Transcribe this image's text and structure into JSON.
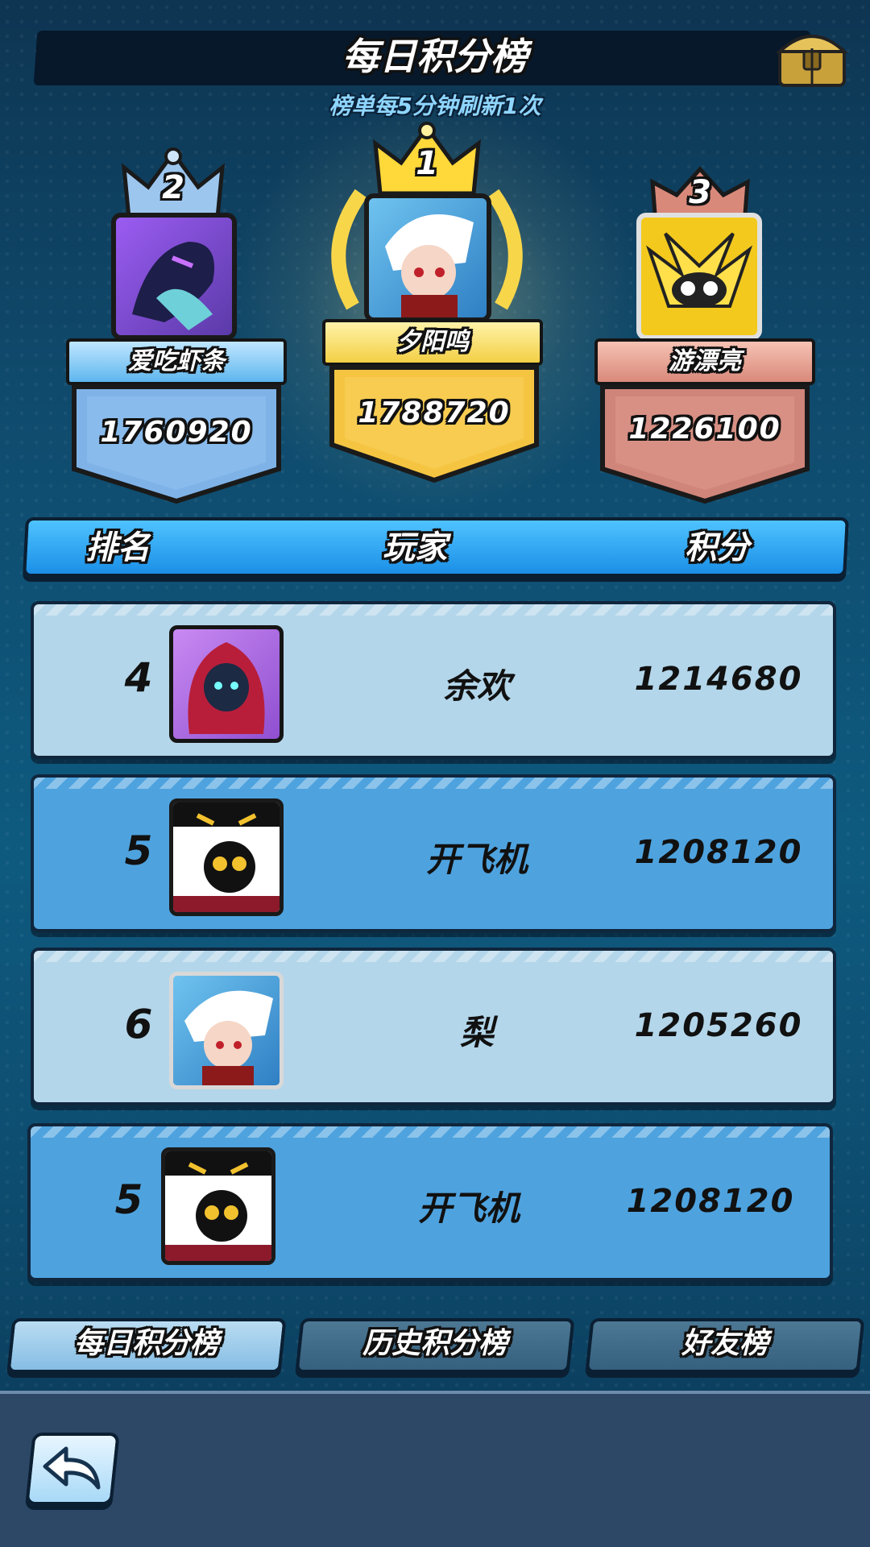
{
  "header": {
    "title": "每日积分榜",
    "subtitle": "榜单每5分钟刷新1次",
    "chest_icon": "treasure-chest-icon"
  },
  "podium": [
    {
      "rank": "1",
      "name": "夕阳鸣",
      "score": "1788720",
      "color": "#f5c542"
    },
    {
      "rank": "2",
      "name": "爱吃虾条",
      "score": "1760920",
      "color": "#7fb3e8"
    },
    {
      "rank": "3",
      "name": "游漂亮",
      "score": "1226100",
      "color": "#d9897a"
    }
  ],
  "table_header": {
    "rank": "排名",
    "player": "玩家",
    "score": "积分"
  },
  "rows": [
    {
      "rank": "4",
      "name": "余欢",
      "score": "1214680"
    },
    {
      "rank": "5",
      "name": "开飞机",
      "score": "1208120"
    },
    {
      "rank": "6",
      "name": "梨",
      "score": "1205260"
    }
  ],
  "my_row": {
    "rank": "5",
    "name": "开飞机",
    "score": "1208120"
  },
  "tabs": [
    {
      "label": "每日积分榜",
      "active": true
    },
    {
      "label": "历史积分榜",
      "active": false
    },
    {
      "label": "好友榜",
      "active": false
    }
  ],
  "back_icon": "back-arrow-icon"
}
